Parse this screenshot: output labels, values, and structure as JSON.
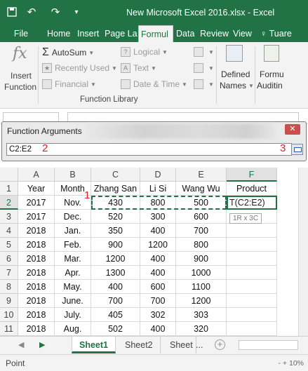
{
  "colors": {
    "excel_green": "#217346",
    "marker_red": "#e02020"
  },
  "titlebar": {
    "title": "New Microsoft Excel 2016.xlsx - Excel",
    "icons": [
      "save-icon",
      "undo-icon",
      "redo-icon",
      "quick-access-dropdown-icon"
    ]
  },
  "tabs": [
    "File",
    "Home",
    "Insert",
    "Page La",
    "Formul",
    "Data",
    "Review",
    "View",
    "Tell me"
  ],
  "tabs_display": {
    "tell": "Tuare"
  },
  "ribbon": {
    "insert_function_line1": "Insert",
    "insert_function_line2": "Function",
    "fx_glyph": "fx",
    "autosum": "AutoSum",
    "recently_used": "Recently Used",
    "financial": "Financial",
    "logical": "Logical",
    "text": "Text",
    "date_time": "Date & Time",
    "defined_names_line1": "Defined",
    "defined_names_line2": "Names",
    "formula_auditing_line1": "Formu",
    "formula_auditing_line2": "Auditin",
    "group_label": "Function Library"
  },
  "dialog": {
    "title": "Function Arguments",
    "close_glyph": "✕",
    "input_value": "C2:E2",
    "markers": {
      "m1": "1",
      "m2": "2",
      "m3": "3"
    }
  },
  "sheet": {
    "columns": [
      "A",
      "B",
      "C",
      "D",
      "E",
      "F"
    ],
    "rows": [
      {
        "num": "1",
        "cells": [
          "Year",
          "Month",
          "Zhang San",
          "Li Si",
          "Wang Wu",
          "Product"
        ]
      },
      {
        "num": "2",
        "cells": [
          "2017",
          "Nov.",
          "430",
          "800",
          "500",
          ""
        ]
      },
      {
        "num": "3",
        "cells": [
          "2017",
          "Dec.",
          "520",
          "300",
          "600",
          ""
        ]
      },
      {
        "num": "4",
        "cells": [
          "2018",
          "Jan.",
          "350",
          "400",
          "700",
          ""
        ]
      },
      {
        "num": "5",
        "cells": [
          "2018",
          "Feb.",
          "900",
          "1200",
          "800",
          ""
        ]
      },
      {
        "num": "6",
        "cells": [
          "2018",
          "Mar.",
          "1200",
          "400",
          "900",
          ""
        ]
      },
      {
        "num": "7",
        "cells": [
          "2018",
          "Apr.",
          "1300",
          "400",
          "1000",
          ""
        ]
      },
      {
        "num": "8",
        "cells": [
          "2018",
          "May.",
          "400",
          "600",
          "1100",
          ""
        ]
      },
      {
        "num": "9",
        "cells": [
          "2018",
          "June.",
          "700",
          "700",
          "1200",
          ""
        ]
      },
      {
        "num": "10",
        "cells": [
          "2018",
          "July.",
          "405",
          "302",
          "303",
          ""
        ]
      },
      {
        "num": "11",
        "cells": [
          "2018",
          "Aug.",
          "502",
          "400",
          "320",
          ""
        ]
      }
    ],
    "active_cell_formula": "T(C2:E2)",
    "selection_tooltip": "1R x 3C"
  },
  "sheet_tabs": [
    "Sheet1",
    "Sheet2",
    "Sheet"
  ],
  "sheet_tabs_more": "...",
  "statusbar": {
    "mode": "Point",
    "zoom": "- + 10%"
  }
}
